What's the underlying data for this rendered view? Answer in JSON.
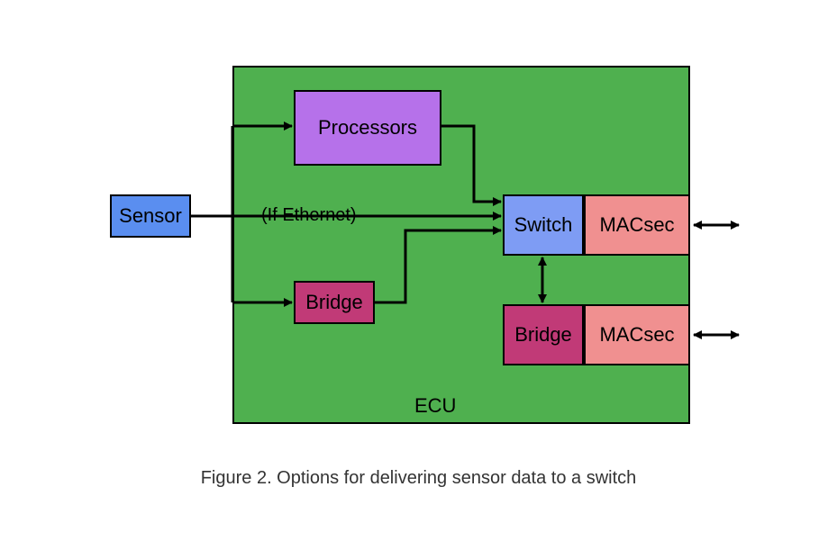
{
  "diagram": {
    "container_label": "ECU",
    "nodes": {
      "sensor": "Sensor",
      "processors": "Processors",
      "bridge1": "Bridge",
      "switch": "Switch",
      "macsec1": "MACsec",
      "bridge2": "Bridge",
      "macsec2": "MACsec"
    },
    "edge_label": "(If Ethernet)",
    "colors": {
      "ecu_bg": "#4fb04f",
      "sensor_bg": "#5a8ef0",
      "processors_bg": "#b671ea",
      "bridge_bg": "#c13a77",
      "switch_bg": "#7e9cf4",
      "macsec_bg": "#f09090"
    },
    "edges": [
      {
        "from": "sensor",
        "to": "processors",
        "label": null
      },
      {
        "from": "sensor",
        "to": "switch",
        "label": "(If Ethernet)"
      },
      {
        "from": "sensor",
        "to": "bridge1",
        "label": null
      },
      {
        "from": "processors",
        "to": "switch",
        "label": null
      },
      {
        "from": "bridge1",
        "to": "switch",
        "label": null
      },
      {
        "from": "switch",
        "to": "bridge2",
        "bidirectional": true
      },
      {
        "from": "macsec1",
        "to": "external",
        "bidirectional": true
      },
      {
        "from": "macsec2",
        "to": "external",
        "bidirectional": true
      }
    ]
  },
  "caption": "Figure 2. Options for delivering sensor data to a switch"
}
